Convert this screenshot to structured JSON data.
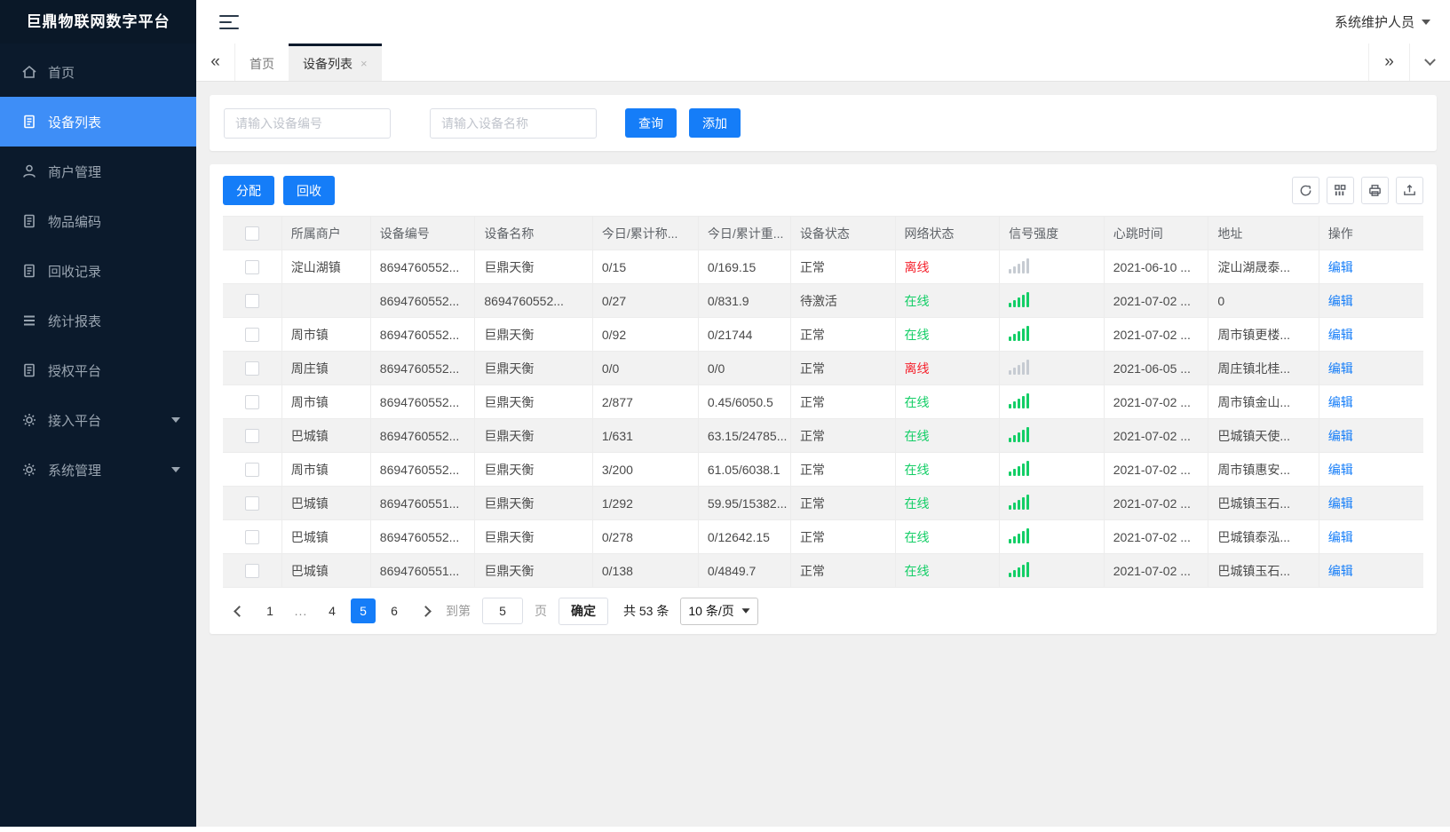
{
  "app": {
    "title": "巨鼎物联网数字平台",
    "user": "系统维护人员"
  },
  "colors": {
    "accent": "#157df8",
    "sidebar_bg": "#0b1a2c",
    "menu_active": "#3e8ef7",
    "online_green": "#13ce66",
    "offline_red": "#f5222d"
  },
  "sidebar": {
    "items": [
      {
        "label": "首页",
        "icon": "home-icon",
        "active": false,
        "expandable": false
      },
      {
        "label": "设备列表",
        "icon": "device-list-icon",
        "active": true,
        "expandable": false
      },
      {
        "label": "商户管理",
        "icon": "merchant-user-icon",
        "active": false,
        "expandable": false
      },
      {
        "label": "物品编码",
        "icon": "item-code-icon",
        "active": false,
        "expandable": false
      },
      {
        "label": "回收记录",
        "icon": "recycle-record-icon",
        "active": false,
        "expandable": false
      },
      {
        "label": "统计报表",
        "icon": "report-lines-icon",
        "active": false,
        "expandable": false
      },
      {
        "label": "授权平台",
        "icon": "authorize-icon",
        "active": false,
        "expandable": false
      },
      {
        "label": "接入平台",
        "icon": "gear-icon",
        "active": false,
        "expandable": true
      },
      {
        "label": "系统管理",
        "icon": "gear-icon",
        "active": false,
        "expandable": true
      }
    ]
  },
  "tabs": [
    {
      "label": "首页",
      "active": false,
      "closable": false
    },
    {
      "label": "设备列表",
      "active": true,
      "closable": true
    }
  ],
  "search": {
    "device_no_placeholder": "请输入设备编号",
    "device_name_placeholder": "请输入设备名称",
    "query_label": "查询",
    "add_label": "添加"
  },
  "toolbar": {
    "assign_label": "分配",
    "recycle_label": "回收",
    "icons": [
      "refresh-icon",
      "columns-icon",
      "print-icon",
      "export-icon"
    ]
  },
  "table": {
    "headers": [
      "所属商户",
      "设备编号",
      "设备名称",
      "今日/累计称...",
      "今日/累计重...",
      "设备状态",
      "网络状态",
      "信号强度",
      "心跳时间",
      "地址",
      "操作"
    ],
    "edit_label": "编辑",
    "online_label": "在线",
    "offline_label": "离线",
    "rows": [
      {
        "merchant": "淀山湖镇",
        "device_no": "8694760552...",
        "device_name": "巨鼎天衡",
        "today_count": "0/15",
        "today_weight": "0/169.15",
        "status": "正常",
        "network": "离线",
        "online": false,
        "heartbeat": "2021-06-10 ...",
        "address": "淀山湖晟泰..."
      },
      {
        "merchant": "",
        "device_no": "8694760552...",
        "device_name": "8694760552...",
        "today_count": "0/27",
        "today_weight": "0/831.9",
        "status": "待激活",
        "network": "在线",
        "online": true,
        "heartbeat": "2021-07-02 ...",
        "address": "0"
      },
      {
        "merchant": "周市镇",
        "device_no": "8694760552...",
        "device_name": "巨鼎天衡",
        "today_count": "0/92",
        "today_weight": "0/21744",
        "status": "正常",
        "network": "在线",
        "online": true,
        "heartbeat": "2021-07-02 ...",
        "address": "周市镇更楼..."
      },
      {
        "merchant": "周庄镇",
        "device_no": "8694760552...",
        "device_name": "巨鼎天衡",
        "today_count": "0/0",
        "today_weight": "0/0",
        "status": "正常",
        "network": "离线",
        "online": false,
        "heartbeat": "2021-06-05 ...",
        "address": "周庄镇北桂..."
      },
      {
        "merchant": "周市镇",
        "device_no": "8694760552...",
        "device_name": "巨鼎天衡",
        "today_count": "2/877",
        "today_weight": "0.45/6050.5",
        "status": "正常",
        "network": "在线",
        "online": true,
        "heartbeat": "2021-07-02 ...",
        "address": "周市镇金山..."
      },
      {
        "merchant": "巴城镇",
        "device_no": "8694760552...",
        "device_name": "巨鼎天衡",
        "today_count": "1/631",
        "today_weight": "63.15/24785...",
        "status": "正常",
        "network": "在线",
        "online": true,
        "heartbeat": "2021-07-02 ...",
        "address": "巴城镇天使..."
      },
      {
        "merchant": "周市镇",
        "device_no": "8694760552...",
        "device_name": "巨鼎天衡",
        "today_count": "3/200",
        "today_weight": "61.05/6038.1",
        "status": "正常",
        "network": "在线",
        "online": true,
        "heartbeat": "2021-07-02 ...",
        "address": "周市镇惠安..."
      },
      {
        "merchant": "巴城镇",
        "device_no": "8694760551...",
        "device_name": "巨鼎天衡",
        "today_count": "1/292",
        "today_weight": "59.95/15382...",
        "status": "正常",
        "network": "在线",
        "online": true,
        "heartbeat": "2021-07-02 ...",
        "address": "巴城镇玉石..."
      },
      {
        "merchant": "巴城镇",
        "device_no": "8694760552...",
        "device_name": "巨鼎天衡",
        "today_count": "0/278",
        "today_weight": "0/12642.15",
        "status": "正常",
        "network": "在线",
        "online": true,
        "heartbeat": "2021-07-02 ...",
        "address": "巴城镇泰泓..."
      },
      {
        "merchant": "巴城镇",
        "device_no": "8694760551...",
        "device_name": "巨鼎天衡",
        "today_count": "0/138",
        "today_weight": "0/4849.7",
        "status": "正常",
        "network": "在线",
        "online": true,
        "heartbeat": "2021-07-02 ...",
        "address": "巴城镇玉石..."
      }
    ]
  },
  "pagination": {
    "pages": [
      {
        "label": "1",
        "active": false,
        "ellipsis": false
      },
      {
        "label": "...",
        "active": false,
        "ellipsis": true
      },
      {
        "label": "4",
        "active": false,
        "ellipsis": false
      },
      {
        "label": "5",
        "active": true,
        "ellipsis": false
      },
      {
        "label": "6",
        "active": false,
        "ellipsis": false
      }
    ],
    "goto_label": "到第",
    "goto_value": "5",
    "page_label": "页",
    "confirm_label": "确定",
    "total_label": "共 53 条",
    "page_size": "10 条/页"
  }
}
